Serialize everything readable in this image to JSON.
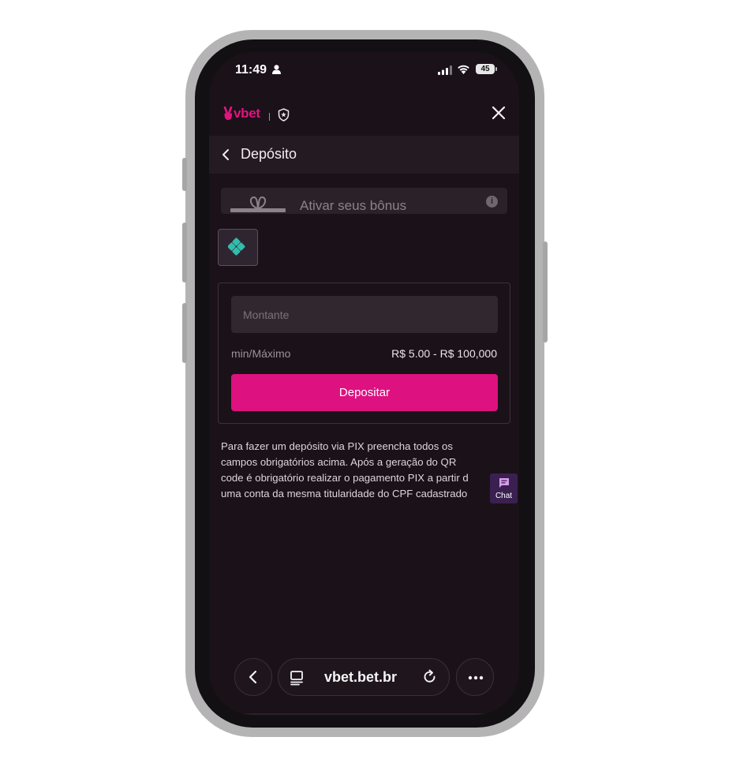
{
  "status_bar": {
    "time": "11:49",
    "battery": "45"
  },
  "header": {
    "logo": "vbet",
    "title": "Depósito"
  },
  "bonus": {
    "label": "Ativar seus bônus",
    "info": "i"
  },
  "form": {
    "amount_placeholder": "Montante",
    "range_label": "min/Máximo",
    "range_value": "R$ 5.00 - R$ 100,000",
    "deposit_label": "Depositar"
  },
  "info_text": [
    "Para fazer um depósito via PIX preencha todos os",
    "campos obrigatórios acima. Após a geração do QR",
    "code é obrigatório realizar o pagamento PIX a partir d",
    "uma conta da mesma titularidade do CPF cadastrado"
  ],
  "chat": {
    "label": "Chat"
  },
  "browser": {
    "url": "vbet.bet.br"
  },
  "colors": {
    "brand": "#e3137e",
    "button": "#dd1180",
    "background": "#1b1119",
    "pix": "#32bcad"
  }
}
